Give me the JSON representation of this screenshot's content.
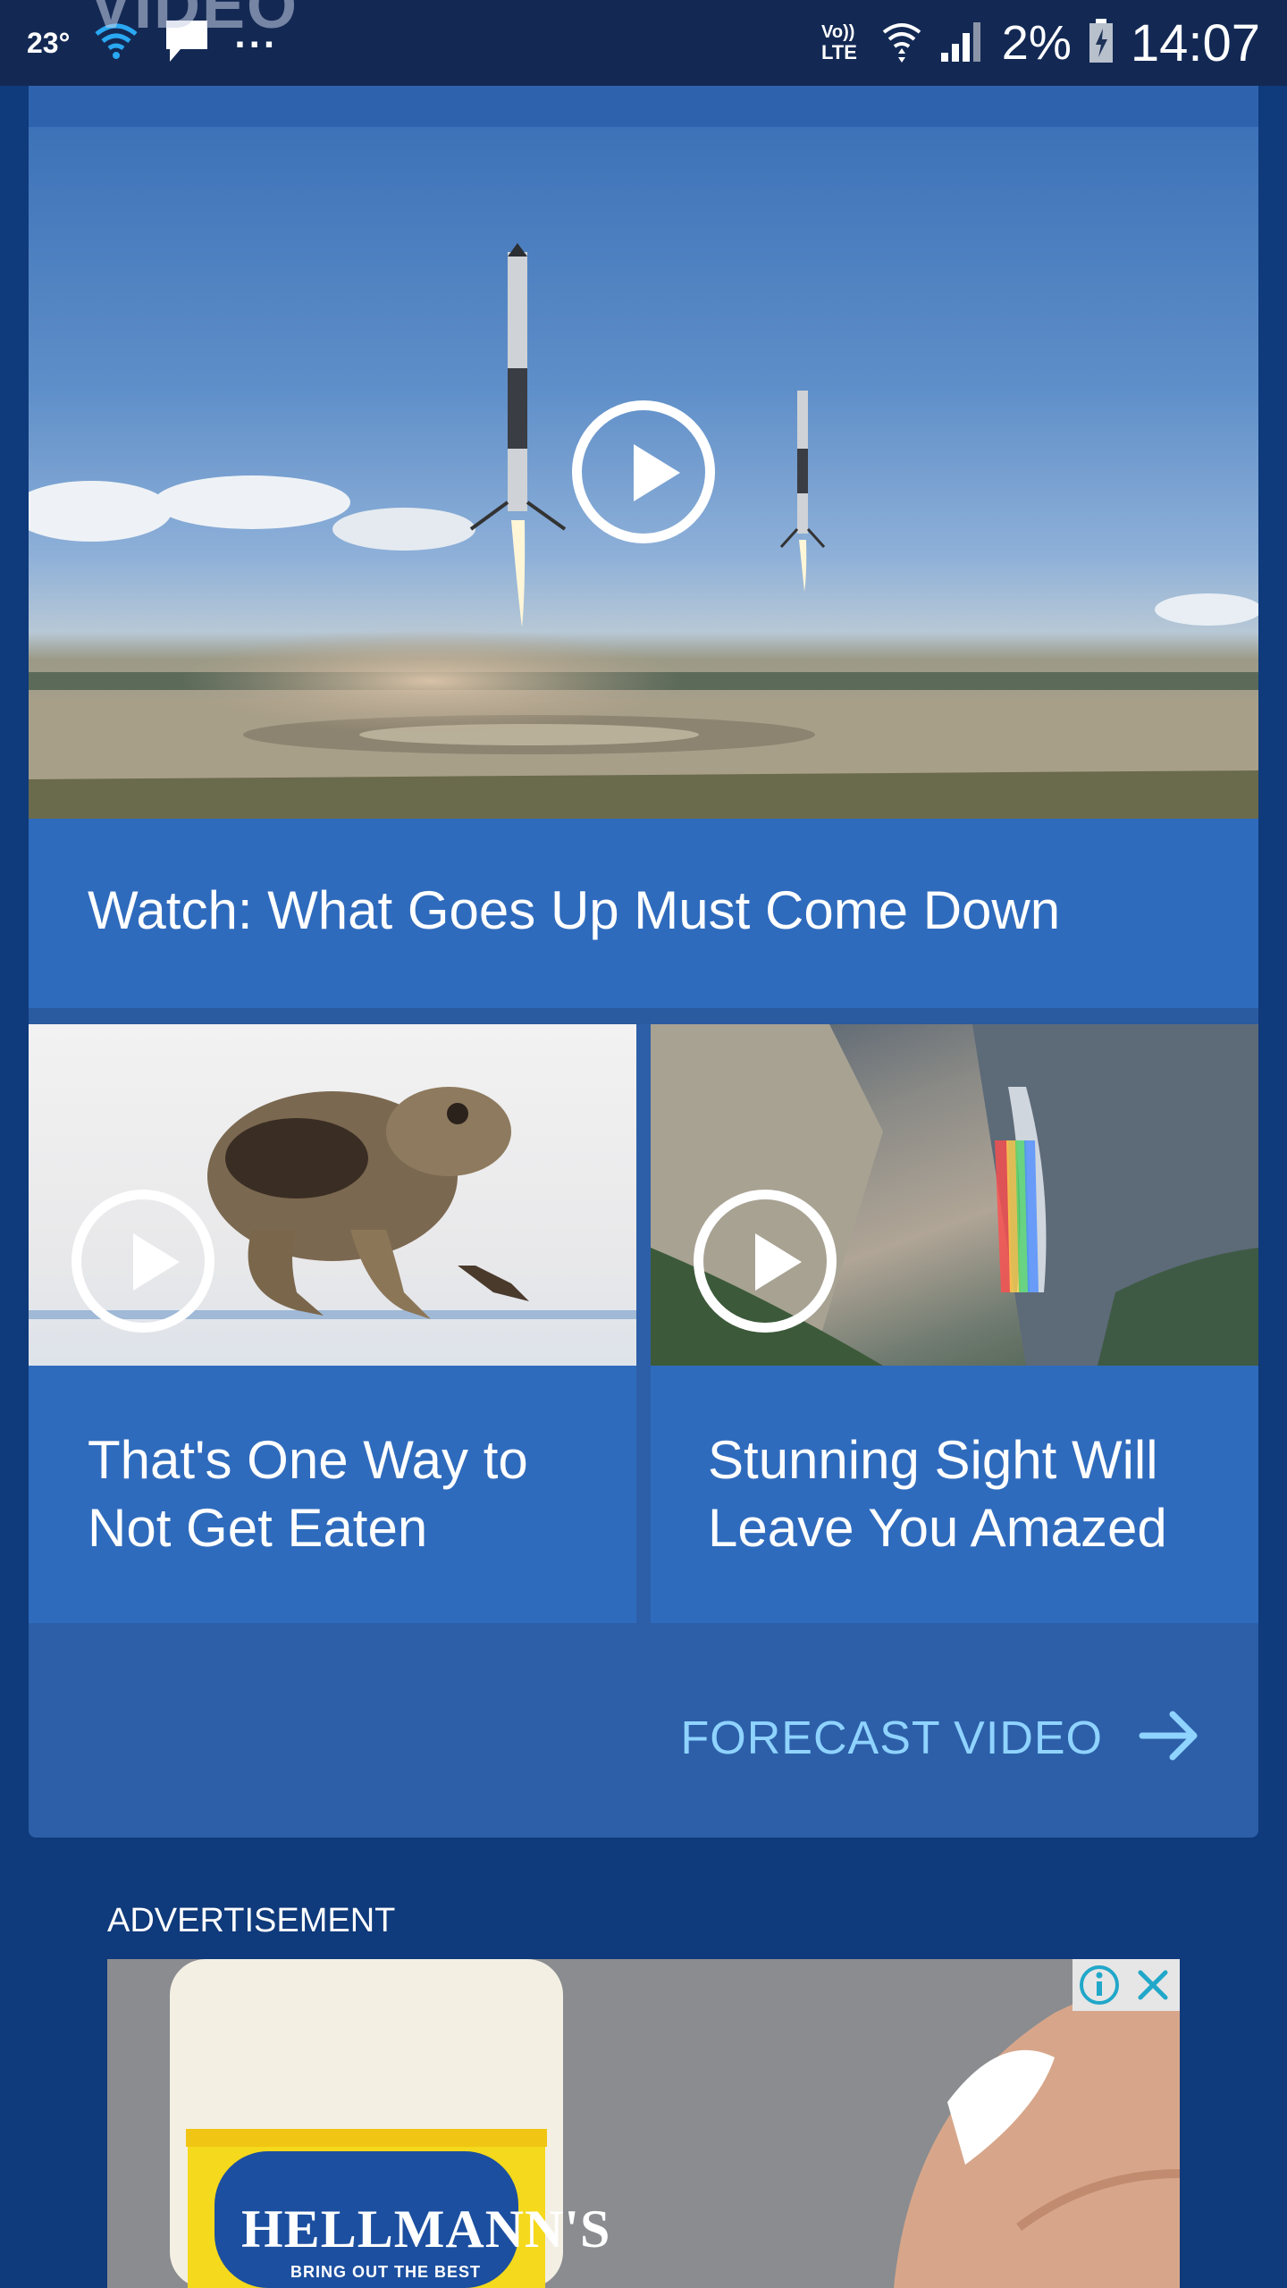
{
  "status_bar": {
    "temperature": "23°",
    "dots": "...",
    "network": "Vo)) LTE",
    "battery_percent": "2%",
    "time": "14:07"
  },
  "header": {
    "ghost_title": "VIDEO"
  },
  "hero": {
    "title": "Watch: What Goes Up Must Come Down",
    "play_icon": "play-circle-icon"
  },
  "thumbs": [
    {
      "title": "That's One Way to Not Get Eaten",
      "play_icon": "play-circle-icon"
    },
    {
      "title": "Stunning Sight Will Leave You Amazed",
      "play_icon": "play-circle-icon"
    }
  ],
  "forecast": {
    "label": "FORECAST VIDEO",
    "icon": "arrow-right-icon"
  },
  "ad": {
    "label": "ADVERTISEMENT",
    "brand_text": "HELLMANN'S",
    "tagline": "BRING OUT THE BEST",
    "info_icon": "info-icon",
    "close_icon": "close-icon"
  },
  "colors": {
    "background": "#0f3a7b",
    "card": "#2f6bbd",
    "accent_link": "#8fd3ff"
  }
}
